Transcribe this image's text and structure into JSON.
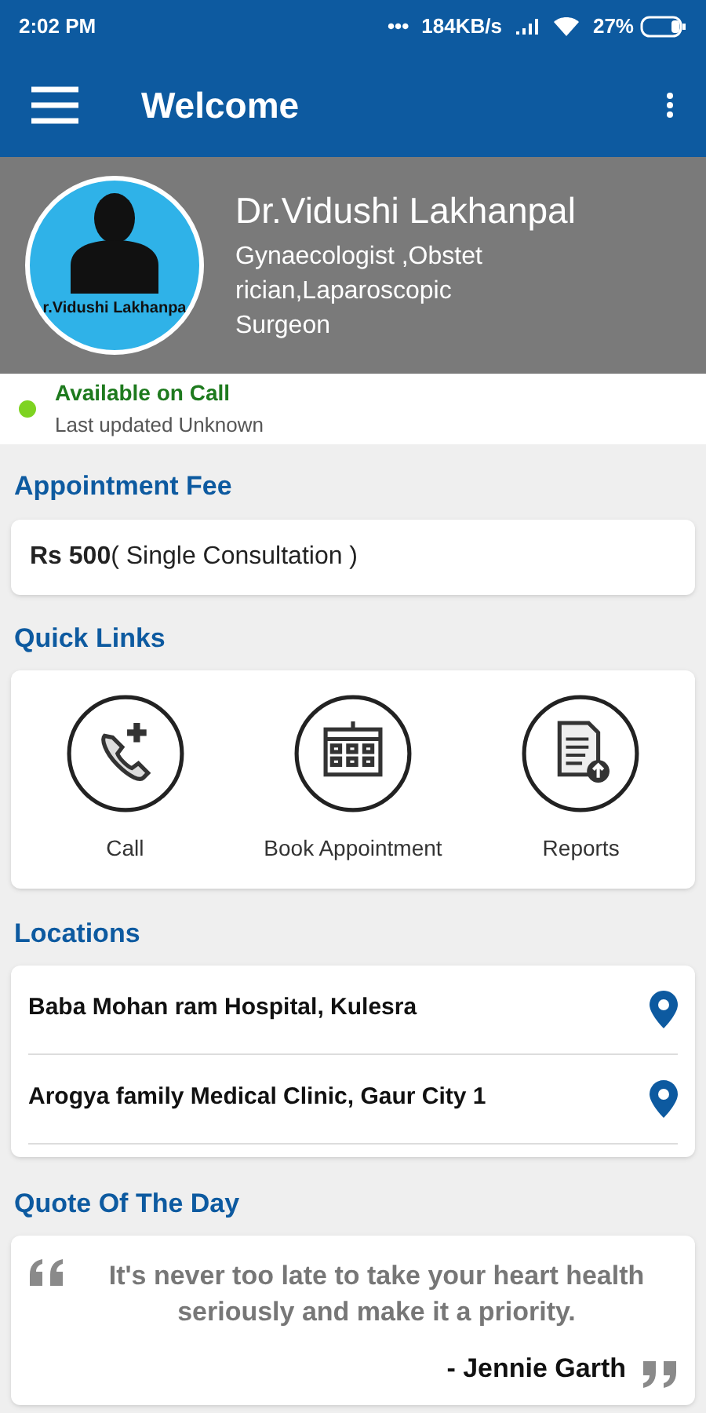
{
  "status_bar": {
    "time": "2:02 PM",
    "dots": "•••",
    "speed": "184KB/s",
    "battery": "27%"
  },
  "app_bar": {
    "title": "Welcome"
  },
  "profile": {
    "avatar_caption": "r.Vidushi Lakhanpa",
    "name": "Dr.Vidushi Lakhanpal",
    "specialty": "Gynaecologist ,Obstet rician,Laparoscopic Surgeon"
  },
  "availability": {
    "status": "Available on Call",
    "color": "#7ed321",
    "updated": "Last updated Unknown"
  },
  "fee": {
    "heading": "Appointment Fee",
    "text": "**Rs 500**( Single Consultation )"
  },
  "quick_links": {
    "heading": "Quick Links",
    "items": [
      {
        "kind": "call",
        "label": "Call"
      },
      {
        "kind": "calendar",
        "label": "Book Appointment"
      },
      {
        "kind": "reports",
        "label": "Reports"
      }
    ]
  },
  "locations": {
    "heading": "Locations",
    "items": [
      {
        "name": "Baba Mohan ram Hospital, Kulesra"
      },
      {
        "name": "Arogya family Medical Clinic, Gaur City 1"
      }
    ]
  },
  "quote": {
    "heading": "Quote Of The Day",
    "text": "It's never too late to take your heart health seriously and make it a priority.",
    "author": "- Jennie Garth"
  }
}
